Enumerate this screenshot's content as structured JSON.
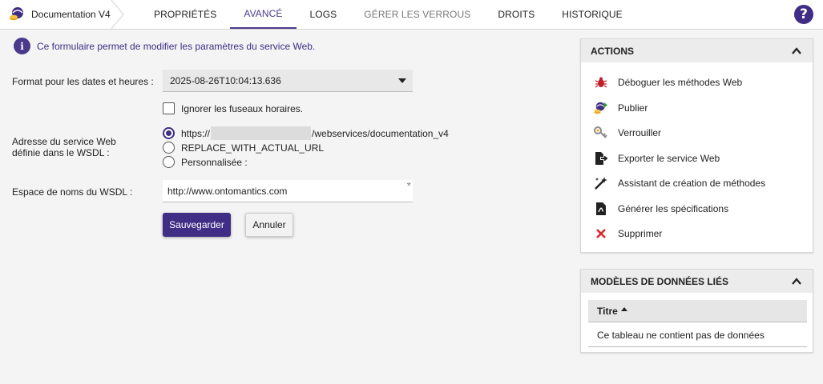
{
  "app": {
    "title": "Documentation V4"
  },
  "tabs": [
    {
      "label": "PROPRIÉTÉS"
    },
    {
      "label": "AVANCÉ"
    },
    {
      "label": "LOGS"
    },
    {
      "label": "GÉRER LES VERROUS"
    },
    {
      "label": "DROITS"
    },
    {
      "label": "HISTORIQUE"
    }
  ],
  "active_tab": "AVANCÉ",
  "help": {
    "label": "?"
  },
  "info": {
    "icon": "i",
    "text": "Ce formulaire permet de modifier les paramètres du service Web."
  },
  "form": {
    "date_format_label": "Format pour les dates et heures :",
    "date_format_value": "2025-08-26T10:04:13.636",
    "ignore_timezones_label": "Ignorer les fuseaux horaires.",
    "ignore_timezones_checked": false,
    "wsdl_address_label_1": "Adresse du service Web",
    "wsdl_address_label_2": "définie dans le WSDL :",
    "wsdl_options": [
      {
        "prefix": "https://",
        "suffix": "/webservices/documentation_v4",
        "checked": true
      },
      {
        "label": "REPLACE_WITH_ACTUAL_URL",
        "checked": false
      },
      {
        "label": "Personnalisée :",
        "checked": false
      }
    ],
    "namespace_label": "Espace de noms du WSDL :",
    "namespace_value": "http://www.ontomantics.com",
    "required_mark": "*",
    "save_label": "Sauvegarder",
    "cancel_label": "Annuler"
  },
  "actions_panel": {
    "title": "ACTIONS",
    "items": [
      {
        "label": "Déboguer les méthodes Web",
        "icon": "bug-icon"
      },
      {
        "label": "Publier",
        "icon": "publish-icon"
      },
      {
        "label": "Verrouiller",
        "icon": "key-icon"
      },
      {
        "label": "Exporter le service Web",
        "icon": "export-icon"
      },
      {
        "label": "Assistant de création de méthodes",
        "icon": "magic-wand-icon"
      },
      {
        "label": "Générer les spécifications",
        "icon": "pdf-file-icon"
      },
      {
        "label": "Supprimer",
        "icon": "delete-icon"
      }
    ]
  },
  "models_panel": {
    "title": "MODÈLES DE DONNÉES LIÉS",
    "column": "Titre",
    "empty_text": "Ce tableau ne contient pas de données"
  },
  "colors": {
    "accent": "#3f2d86",
    "delete": "#d9262c",
    "bug": "#c0202a"
  }
}
